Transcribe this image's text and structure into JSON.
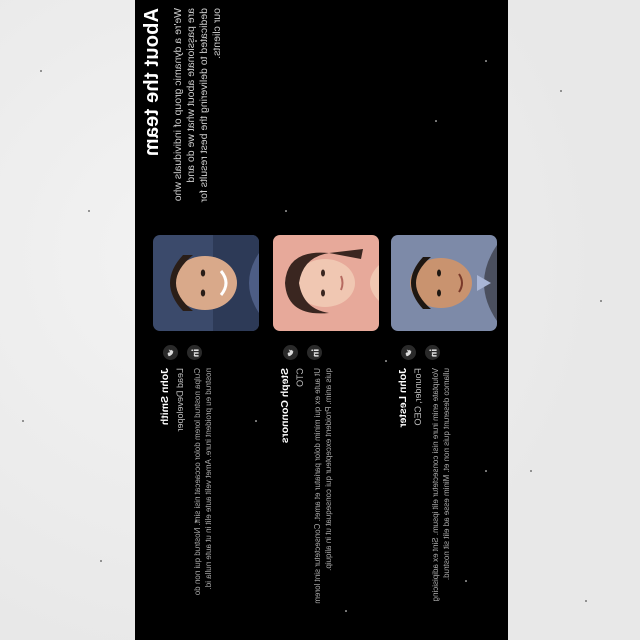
{
  "section": {
    "title": "About the team",
    "intro": "We're a dynamic group of individuals who are passionate about what we do and dedicated to delivering the best results for our clients."
  },
  "members": [
    {
      "name": "John Smith",
      "role": "Lead Developer",
      "bio": "Culpa nostrud lorem dolor occaecat nisi sint. Nostrud qui non do nostrud eu proident irure. Amet velit aute elit in ut aute nulla id.",
      "photo_bg": "#3b4a6b",
      "socials": [
        "twitter-icon",
        "linkedin-icon"
      ]
    },
    {
      "name": "Steph Connors",
      "role": "CTO",
      "bio": "Ut aute ex qui minim dolor pariatur et amet. Consectetur sint lorem quis anim. Proident excepteur qui consequat ut in aliquip.",
      "photo_bg": "#e7a99a",
      "socials": [
        "twitter-icon",
        "linkedin-icon"
      ]
    },
    {
      "name": "John Lester",
      "role": "Founder, CEO",
      "bio": "Voluptate enim irure nisi consectetur elit ipsum. Sint ex adipisicing ullamco deserunt quis non et. Minim esse ad elit sit nostrud.",
      "photo_bg": "#7d8aa8",
      "socials": [
        "twitter-icon",
        "linkedin-icon"
      ]
    }
  ],
  "colors": {
    "panel": "#000000",
    "surround": "#ececec",
    "heading": "#ffffff",
    "body_text": "#cfcfcf"
  }
}
